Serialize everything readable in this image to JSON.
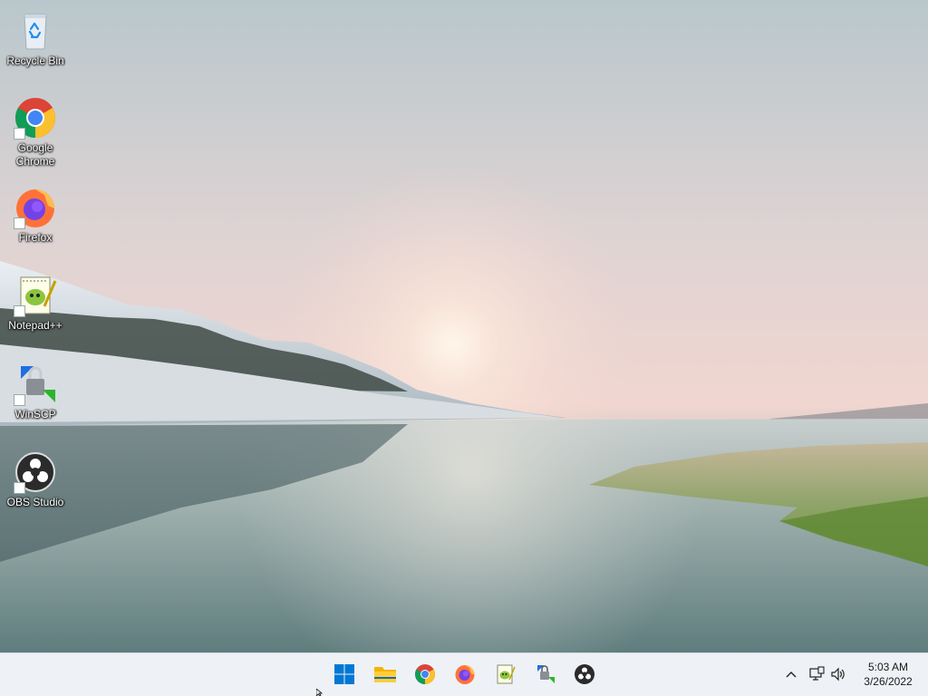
{
  "desktop": {
    "icons": [
      {
        "label": "Recycle Bin",
        "icon": "recycle-bin-icon"
      },
      {
        "label": "Google Chrome",
        "icon": "chrome-icon"
      },
      {
        "label": "Firefox",
        "icon": "firefox-icon"
      },
      {
        "label": "Notepad++",
        "icon": "notepad-plus-plus-icon"
      },
      {
        "label": "WinSCP",
        "icon": "winscp-icon"
      },
      {
        "label": "OBS Studio",
        "icon": "obs-studio-icon"
      }
    ]
  },
  "taskbar": {
    "pinned": [
      {
        "icon": "windows-start-icon"
      },
      {
        "icon": "file-explorer-icon"
      },
      {
        "icon": "chrome-icon"
      },
      {
        "icon": "firefox-icon"
      },
      {
        "icon": "notepad-plus-plus-icon"
      },
      {
        "icon": "winscp-icon"
      },
      {
        "icon": "obs-studio-icon"
      }
    ],
    "tray": {
      "icons": [
        "chevron-up-icon",
        "network-icon",
        "volume-icon"
      ],
      "time": "5:03 AM",
      "date": "3/26/2022"
    }
  },
  "colors": {
    "taskbar_bg": "#eef1f5",
    "windows_blue": "#0078d4"
  }
}
